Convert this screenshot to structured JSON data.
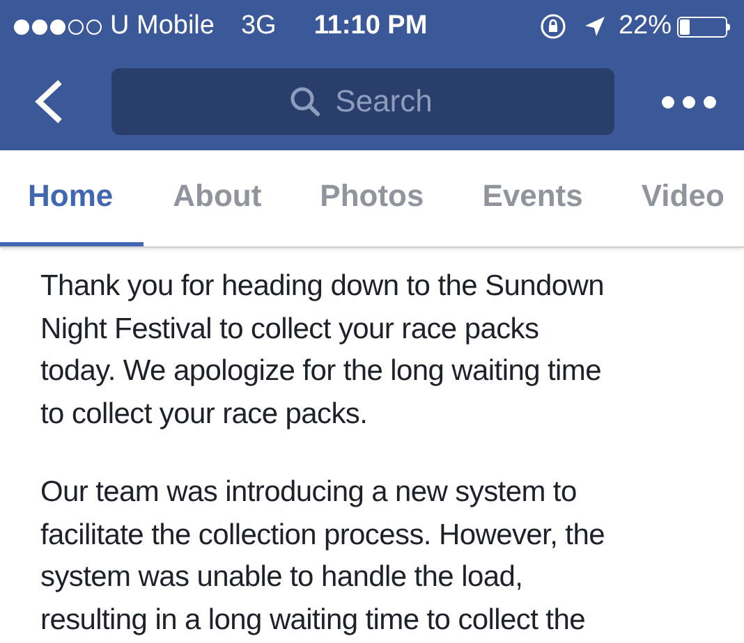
{
  "status_bar": {
    "signal_dots": [
      {
        "filled": true
      },
      {
        "filled": true
      },
      {
        "filled": true
      },
      {
        "filled": false
      },
      {
        "filled": false
      }
    ],
    "carrier": "U Mobile",
    "network": "3G",
    "time": "11:10 PM",
    "battery": "22%"
  },
  "nav_bar": {
    "search": {
      "placeholder": "Search"
    }
  },
  "tabs": [
    {
      "label": "Home",
      "selected": true
    },
    {
      "label": "About",
      "selected": false
    },
    {
      "label": "Photos",
      "selected": false
    },
    {
      "label": "Events",
      "selected": false
    },
    {
      "label": "Video",
      "selected": false
    }
  ],
  "post": {
    "paragraphs": [
      {
        "lines": [
          "Thank you for heading down to the Sundown",
          "Night Festival to collect your race packs",
          "today. We apologize for the long waiting time",
          "to collect your race packs."
        ]
      },
      {
        "lines": [
          "Our team was introducing a new system to",
          "facilitate the collection process. However, the",
          "system was unable to handle the load,",
          "resulting in a long waiting time to collect the"
        ]
      }
    ]
  }
}
